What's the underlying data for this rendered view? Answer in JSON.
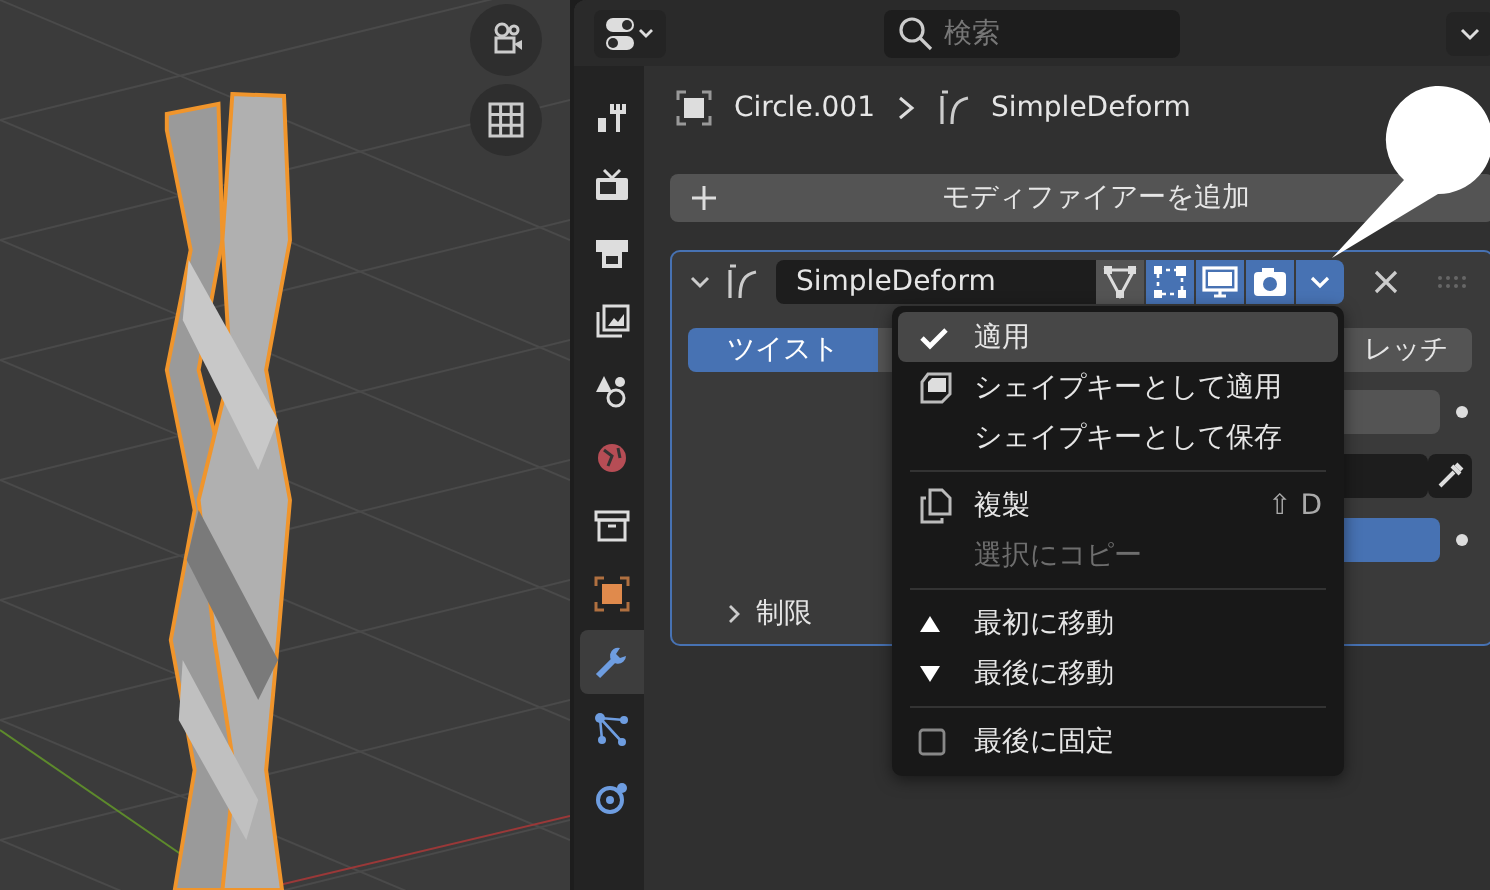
{
  "header": {
    "search": {
      "placeholder": "検索"
    }
  },
  "tabs": [
    {
      "kind": "tool",
      "selected": false
    },
    {
      "kind": "render",
      "selected": false
    },
    {
      "kind": "output",
      "selected": false
    },
    {
      "kind": "view_layer",
      "selected": false
    },
    {
      "kind": "scene",
      "selected": false
    },
    {
      "kind": "world",
      "selected": false
    },
    {
      "kind": "collection",
      "selected": false
    },
    {
      "kind": "object",
      "selected": false
    },
    {
      "kind": "modifiers",
      "selected": true
    },
    {
      "kind": "particles",
      "selected": false
    },
    {
      "kind": "physics",
      "selected": false
    }
  ],
  "breadcrumb": {
    "object": "Circle.001",
    "modifier": "SimpleDeform"
  },
  "add_modifier": {
    "label": "モディファイアーを追加"
  },
  "modifier": {
    "name": "SimpleDeform",
    "expanded": true,
    "toggles": [
      {
        "kind": "cage",
        "on": false
      },
      {
        "kind": "editmode",
        "on": true
      },
      {
        "kind": "viewport",
        "on": true
      },
      {
        "kind": "render",
        "on": true
      }
    ],
    "modes": [
      {
        "label": "ツイスト",
        "selected": true
      },
      {
        "label": "レッチ",
        "selected": false
      }
    ],
    "subpanel": {
      "label": "制限",
      "expanded": false
    }
  },
  "menu": {
    "items": [
      {
        "kind": "check",
        "label": "適用",
        "selected": true,
        "disabled": false
      },
      {
        "kind": "shapekey",
        "label": "シェイプキーとして適用",
        "selected": false,
        "disabled": false
      },
      {
        "kind": "plain",
        "label": "シェイプキーとして保存",
        "selected": false,
        "disabled": false
      },
      {
        "kind": "separator"
      },
      {
        "kind": "duplicate",
        "label": "複製",
        "shortcut": "⇧ D",
        "selected": false,
        "disabled": false
      },
      {
        "kind": "plain",
        "label": "選択にコピー",
        "selected": false,
        "disabled": true
      },
      {
        "kind": "separator"
      },
      {
        "kind": "up",
        "label": "最初に移動",
        "selected": false,
        "disabled": false
      },
      {
        "kind": "down",
        "label": "最後に移動",
        "selected": false,
        "disabled": false
      },
      {
        "kind": "separator"
      },
      {
        "kind": "toggle",
        "label": "最後に固定",
        "checked": false,
        "selected": false,
        "disabled": false
      }
    ]
  }
}
